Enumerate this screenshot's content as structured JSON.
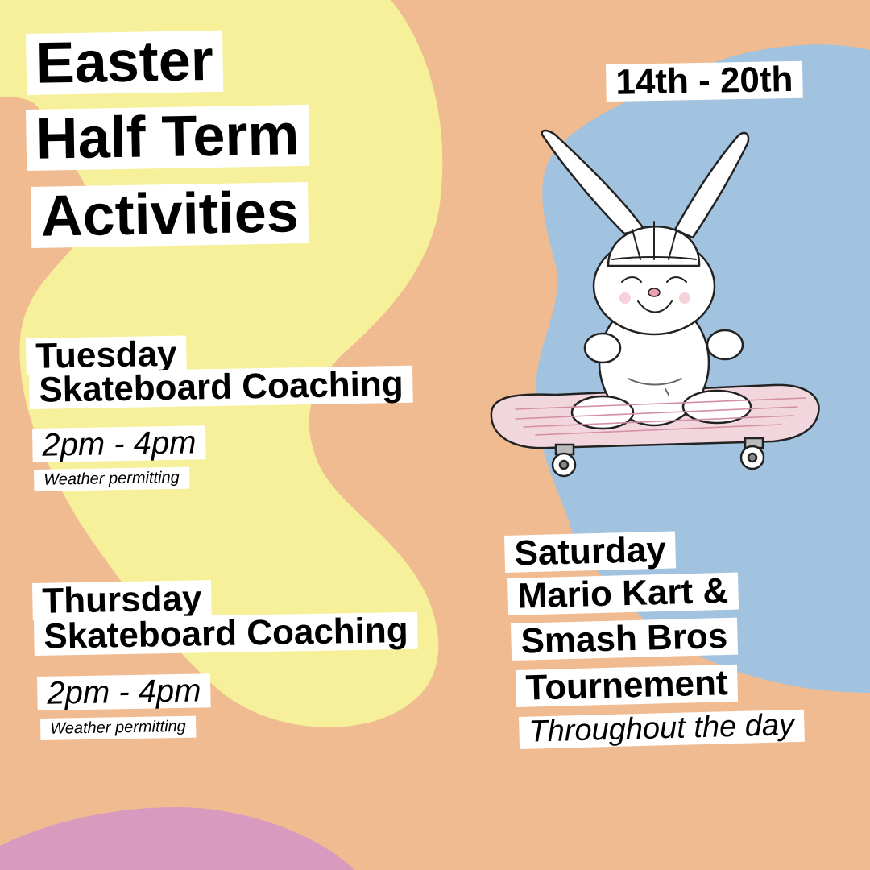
{
  "colors": {
    "background": "#F0BB90",
    "yellow_blob": "#F7F09B",
    "blue_blob": "#A2C3DF",
    "purple_blob": "#D99AC0",
    "label_bg": "#FFFFFF"
  },
  "title": {
    "line1": "Easter",
    "line2": "Half Term",
    "line3": "Activities"
  },
  "dates": "14th - 20th",
  "illustration": {
    "icon": "skateboarding-bunny-illustration"
  },
  "events": {
    "tuesday": {
      "day": "Tuesday",
      "activity": "Skateboard Coaching",
      "time": "2pm - 4pm",
      "note": "Weather permitting"
    },
    "thursday": {
      "day": "Thursday",
      "activity": "Skateboard Coaching",
      "time": "2pm - 4pm",
      "note": "Weather permitting"
    },
    "saturday": {
      "day": "Saturday",
      "line1": "Mario Kart &",
      "line2": "Smash Bros",
      "line3": "Tournement",
      "time": "Throughout the day"
    }
  }
}
